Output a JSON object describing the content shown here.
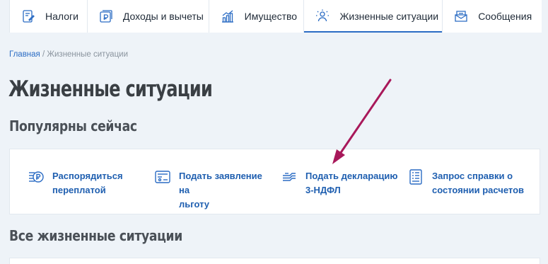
{
  "nav": {
    "tabs": [
      {
        "label": "Налоги",
        "icon": "tax-document-icon",
        "active": false
      },
      {
        "label": "Доходы и вычеты",
        "icon": "income-ruble-icon",
        "active": false
      },
      {
        "label": "Имущество",
        "icon": "property-chart-icon",
        "active": false
      },
      {
        "label": "Жизненные ситуации",
        "icon": "life-situations-icon",
        "active": true
      },
      {
        "label": "Сообщения",
        "icon": "messages-icon",
        "active": false
      }
    ]
  },
  "breadcrumb": {
    "home": "Главная",
    "separator": " / ",
    "current": "Жизненные ситуации"
  },
  "page": {
    "title": "Жизненные ситуации"
  },
  "popular": {
    "title": "Популярны сейчас",
    "items": [
      {
        "line1": "Распорядиться",
        "line2": "переплатой",
        "icon": "ruble-coins-icon"
      },
      {
        "line1": "Подать заявление на",
        "line2": "льготу",
        "icon": "application-form-icon"
      },
      {
        "line1": "Подать декларацию",
        "line2": "3-НДФЛ",
        "icon": "declaration-icon"
      },
      {
        "line1": "Запрос справки о",
        "line2": "состоянии расчетов",
        "icon": "certificate-list-icon"
      }
    ]
  },
  "all_situations": {
    "title": "Все жизненные ситуации"
  },
  "colors": {
    "accent": "#2b6cc4",
    "link": "#1f5fb0",
    "annotation_arrow": "#a8185a",
    "background": "#eef3f8"
  }
}
